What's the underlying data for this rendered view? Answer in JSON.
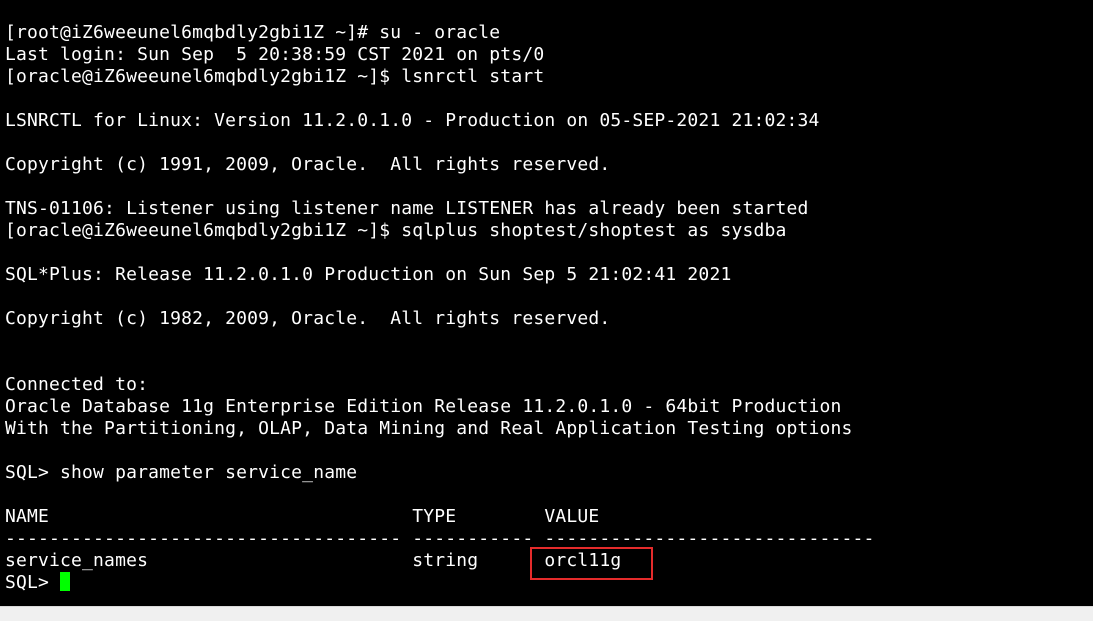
{
  "terminal": {
    "lines": [
      "[root@iZ6weeunel6mqbdly2gbi1Z ~]# su - oracle",
      "Last login: Sun Sep  5 20:38:59 CST 2021 on pts/0",
      "[oracle@iZ6weeunel6mqbdly2gbi1Z ~]$ lsnrctl start",
      "",
      "LSNRCTL for Linux: Version 11.2.0.1.0 - Production on 05-SEP-2021 21:02:34",
      "",
      "Copyright (c) 1991, 2009, Oracle.  All rights reserved.",
      "",
      "TNS-01106: Listener using listener name LISTENER has already been started",
      "[oracle@iZ6weeunel6mqbdly2gbi1Z ~]$ sqlplus shoptest/shoptest as sysdba",
      "",
      "SQL*Plus: Release 11.2.0.1.0 Production on Sun Sep 5 21:02:41 2021",
      "",
      "Copyright (c) 1982, 2009, Oracle.  All rights reserved.",
      "",
      "",
      "Connected to:",
      "Oracle Database 11g Enterprise Edition Release 11.2.0.1.0 - 64bit Production",
      "With the Partitioning, OLAP, Data Mining and Real Application Testing options",
      "",
      "SQL> show parameter service_name",
      "",
      "NAME                                 TYPE        VALUE",
      "------------------------------------ ----------- ------------------------------",
      "service_names                        string      orcl11g"
    ],
    "prompt": "SQL> ",
    "colors": {
      "background": "#000000",
      "text": "#ffffff",
      "cursor": "#00ff00",
      "highlight_border": "#e52b2b"
    }
  }
}
